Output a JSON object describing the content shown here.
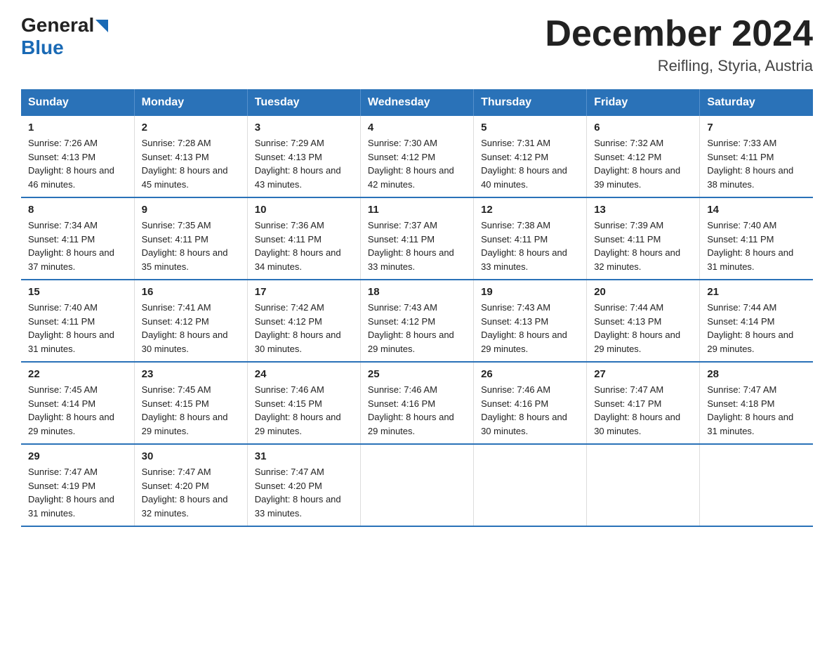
{
  "header": {
    "month_title": "December 2024",
    "location": "Reifling, Styria, Austria",
    "logo_line1": "General",
    "logo_line2": "Blue"
  },
  "days_of_week": [
    "Sunday",
    "Monday",
    "Tuesday",
    "Wednesday",
    "Thursday",
    "Friday",
    "Saturday"
  ],
  "weeks": [
    [
      {
        "day": "1",
        "sunrise": "7:26 AM",
        "sunset": "4:13 PM",
        "daylight": "8 hours and 46 minutes."
      },
      {
        "day": "2",
        "sunrise": "7:28 AM",
        "sunset": "4:13 PM",
        "daylight": "8 hours and 45 minutes."
      },
      {
        "day": "3",
        "sunrise": "7:29 AM",
        "sunset": "4:13 PM",
        "daylight": "8 hours and 43 minutes."
      },
      {
        "day": "4",
        "sunrise": "7:30 AM",
        "sunset": "4:12 PM",
        "daylight": "8 hours and 42 minutes."
      },
      {
        "day": "5",
        "sunrise": "7:31 AM",
        "sunset": "4:12 PM",
        "daylight": "8 hours and 40 minutes."
      },
      {
        "day": "6",
        "sunrise": "7:32 AM",
        "sunset": "4:12 PM",
        "daylight": "8 hours and 39 minutes."
      },
      {
        "day": "7",
        "sunrise": "7:33 AM",
        "sunset": "4:11 PM",
        "daylight": "8 hours and 38 minutes."
      }
    ],
    [
      {
        "day": "8",
        "sunrise": "7:34 AM",
        "sunset": "4:11 PM",
        "daylight": "8 hours and 37 minutes."
      },
      {
        "day": "9",
        "sunrise": "7:35 AM",
        "sunset": "4:11 PM",
        "daylight": "8 hours and 35 minutes."
      },
      {
        "day": "10",
        "sunrise": "7:36 AM",
        "sunset": "4:11 PM",
        "daylight": "8 hours and 34 minutes."
      },
      {
        "day": "11",
        "sunrise": "7:37 AM",
        "sunset": "4:11 PM",
        "daylight": "8 hours and 33 minutes."
      },
      {
        "day": "12",
        "sunrise": "7:38 AM",
        "sunset": "4:11 PM",
        "daylight": "8 hours and 33 minutes."
      },
      {
        "day": "13",
        "sunrise": "7:39 AM",
        "sunset": "4:11 PM",
        "daylight": "8 hours and 32 minutes."
      },
      {
        "day": "14",
        "sunrise": "7:40 AM",
        "sunset": "4:11 PM",
        "daylight": "8 hours and 31 minutes."
      }
    ],
    [
      {
        "day": "15",
        "sunrise": "7:40 AM",
        "sunset": "4:11 PM",
        "daylight": "8 hours and 31 minutes."
      },
      {
        "day": "16",
        "sunrise": "7:41 AM",
        "sunset": "4:12 PM",
        "daylight": "8 hours and 30 minutes."
      },
      {
        "day": "17",
        "sunrise": "7:42 AM",
        "sunset": "4:12 PM",
        "daylight": "8 hours and 30 minutes."
      },
      {
        "day": "18",
        "sunrise": "7:43 AM",
        "sunset": "4:12 PM",
        "daylight": "8 hours and 29 minutes."
      },
      {
        "day": "19",
        "sunrise": "7:43 AM",
        "sunset": "4:13 PM",
        "daylight": "8 hours and 29 minutes."
      },
      {
        "day": "20",
        "sunrise": "7:44 AM",
        "sunset": "4:13 PM",
        "daylight": "8 hours and 29 minutes."
      },
      {
        "day": "21",
        "sunrise": "7:44 AM",
        "sunset": "4:14 PM",
        "daylight": "8 hours and 29 minutes."
      }
    ],
    [
      {
        "day": "22",
        "sunrise": "7:45 AM",
        "sunset": "4:14 PM",
        "daylight": "8 hours and 29 minutes."
      },
      {
        "day": "23",
        "sunrise": "7:45 AM",
        "sunset": "4:15 PM",
        "daylight": "8 hours and 29 minutes."
      },
      {
        "day": "24",
        "sunrise": "7:46 AM",
        "sunset": "4:15 PM",
        "daylight": "8 hours and 29 minutes."
      },
      {
        "day": "25",
        "sunrise": "7:46 AM",
        "sunset": "4:16 PM",
        "daylight": "8 hours and 29 minutes."
      },
      {
        "day": "26",
        "sunrise": "7:46 AM",
        "sunset": "4:16 PM",
        "daylight": "8 hours and 30 minutes."
      },
      {
        "day": "27",
        "sunrise": "7:47 AM",
        "sunset": "4:17 PM",
        "daylight": "8 hours and 30 minutes."
      },
      {
        "day": "28",
        "sunrise": "7:47 AM",
        "sunset": "4:18 PM",
        "daylight": "8 hours and 31 minutes."
      }
    ],
    [
      {
        "day": "29",
        "sunrise": "7:47 AM",
        "sunset": "4:19 PM",
        "daylight": "8 hours and 31 minutes."
      },
      {
        "day": "30",
        "sunrise": "7:47 AM",
        "sunset": "4:20 PM",
        "daylight": "8 hours and 32 minutes."
      },
      {
        "day": "31",
        "sunrise": "7:47 AM",
        "sunset": "4:20 PM",
        "daylight": "8 hours and 33 minutes."
      },
      null,
      null,
      null,
      null
    ]
  ]
}
